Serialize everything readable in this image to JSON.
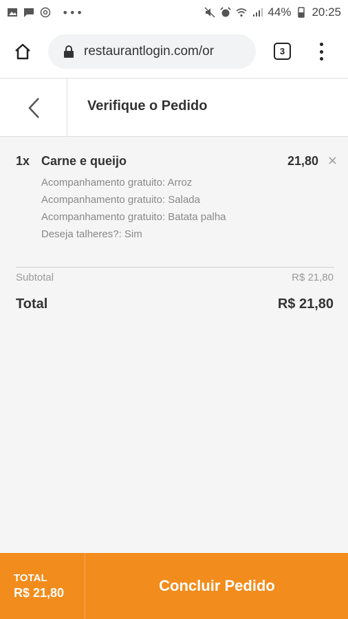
{
  "status_bar": {
    "battery": "44%",
    "time": "20:25",
    "left_icons": [
      "gallery-icon",
      "message-icon",
      "at-icon",
      "more-dots-icon"
    ],
    "right_icons": [
      "mute-icon",
      "alarm-icon",
      "wifi-icon",
      "signal-icon",
      "battery-icon"
    ]
  },
  "browser": {
    "url": "restaurantlogin.com/or",
    "tab_count": "3"
  },
  "header": {
    "title": "Verifique o Pedido"
  },
  "order": {
    "items": [
      {
        "qty": "1x",
        "name": "Carne e queijo",
        "price": "21,80",
        "remove": "×",
        "options": [
          "Acompanhamento gratuito: Arroz",
          "Acompanhamento gratuito: Salada",
          "Acompanhamento gratuito: Batata palha",
          "Deseja talheres?: Sim"
        ]
      }
    ],
    "subtotal_label": "Subtotal",
    "subtotal_value": "R$ 21,80",
    "total_label": "Total",
    "total_value": "R$ 21,80"
  },
  "bottom_bar": {
    "total_label": "TOTAL",
    "total_value": "R$ 21,80",
    "button_label": "Concluir Pedido"
  },
  "colors": {
    "accent": "#f28c1c",
    "background": "#f5f5f5"
  }
}
